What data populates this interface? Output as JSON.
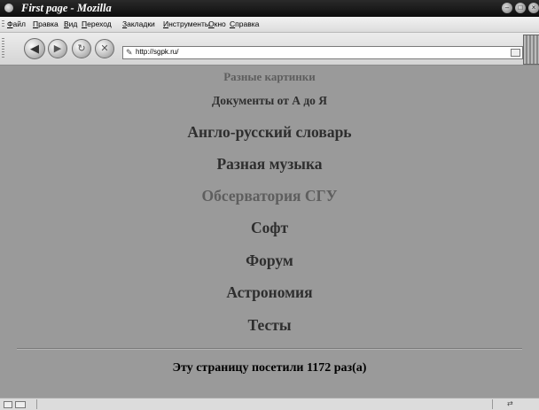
{
  "window": {
    "title": "First page - Mozilla"
  },
  "menu": {
    "items": [
      {
        "accel": "Ф",
        "rest": "айл"
      },
      {
        "accel": "П",
        "rest": "равка"
      },
      {
        "accel": "В",
        "rest": "ид"
      },
      {
        "accel": "П",
        "rest": "ереход"
      },
      {
        "accel": "З",
        "rest": "акладки"
      },
      {
        "accel": "И",
        "rest": "нструменты"
      },
      {
        "accel": "О",
        "rest": "кно"
      },
      {
        "accel": "С",
        "rest": "правка"
      }
    ]
  },
  "nav": {
    "url": "http://sgpk.ru/"
  },
  "links": [
    {
      "label": "Разные картинки"
    },
    {
      "label": "Документы от А до Я"
    },
    {
      "label": "Англо-русский словарь"
    },
    {
      "label": "Разная музыка"
    },
    {
      "label": "Обсерватория СГУ"
    },
    {
      "label": "Софт"
    },
    {
      "label": "Форум"
    },
    {
      "label": "Астрономия"
    },
    {
      "label": "Тесты"
    }
  ],
  "counter": {
    "text": "Эту страницу посетили 1172 раз(а)"
  },
  "colors": {
    "page_bg": "#9a9a9a",
    "link": "#2e2e2e",
    "link_dim": "#5e5e5e"
  }
}
